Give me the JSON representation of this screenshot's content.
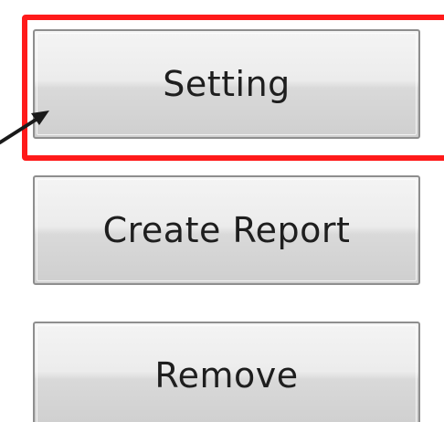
{
  "buttons": {
    "setting_label": "Setting",
    "create_report_label": "Create Report",
    "remove_label": "Remove"
  },
  "annotation": {
    "highlight_color": "#ff1a1a",
    "arrow_color": "#1a1a1a",
    "highlight_target": "setting-button"
  }
}
